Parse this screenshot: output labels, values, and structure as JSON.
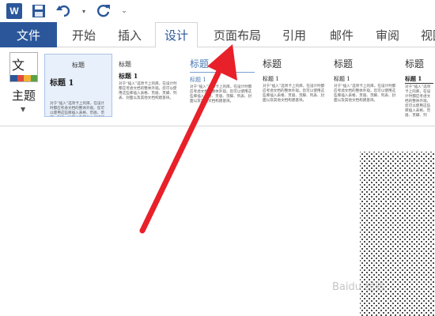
{
  "qat": {
    "app_logo": "W",
    "icons": [
      "word-logo",
      "save-icon",
      "undo-icon",
      "redo-icon",
      "customize-icon"
    ]
  },
  "tabs": [
    "文件",
    "开始",
    "插入",
    "设计",
    "页面布局",
    "引用",
    "邮件",
    "审阅",
    "视图"
  ],
  "active_tab": "设计",
  "ribbon": {
    "theme_label": "主题",
    "theme_glyph": "文"
  },
  "style_set": {
    "title": "标题",
    "heading1": "标题 1",
    "body": "对于“插入”选项卡上的库，在设计时都应考虑文档的整体外观。您可以使用这些库插入表格、页眉、页脚、列表、封面以及其他文档构建基块。"
  },
  "watermark": "Baidu 经验",
  "colors": {
    "brand": "#2b579a",
    "arrow": "#e8202a"
  }
}
